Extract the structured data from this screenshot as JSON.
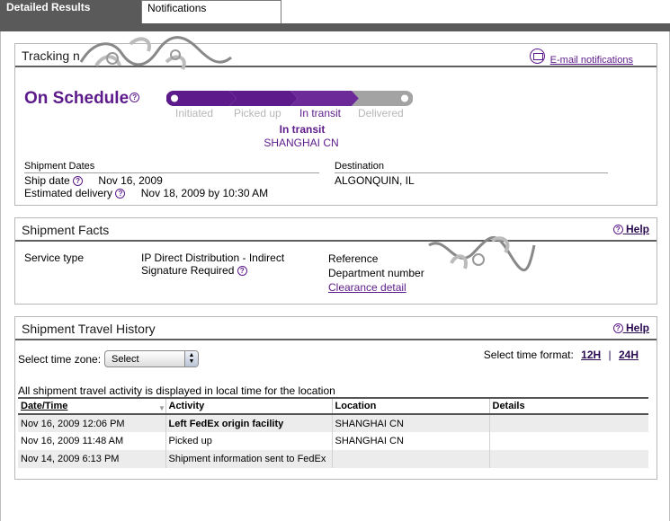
{
  "tabs": {
    "active_label": "Detailed Results",
    "inactive_label": "Notifications"
  },
  "tracking": {
    "title_visible": "Tracking n",
    "email_label": "E-mail notifications",
    "status": "On Schedule",
    "stages": [
      "Initiated",
      "Picked up",
      "In transit",
      "Delivered"
    ],
    "current_stage_index": 2,
    "current_status": "In transit",
    "current_location": "SHANGHAI CN",
    "dates_heading": "Shipment Dates",
    "ship_date_label": "Ship date",
    "ship_date": "Nov 16, 2009",
    "est_delivery_label": "Estimated delivery",
    "est_delivery": "Nov 18, 2009 by 10:30 AM",
    "destination_heading": "Destination",
    "destination": "ALGONQUIN, IL"
  },
  "facts": {
    "title": "Shipment Facts",
    "help": "Help",
    "service_type_label": "Service type",
    "service_line1": "IP Direct Distribution - Indirect",
    "service_line2": "Signature Required",
    "reference_label": "Reference",
    "department_label": "Department number",
    "clearance_link": "Clearance detail"
  },
  "history": {
    "title": "Shipment Travel History",
    "help": "Help",
    "tz_label": "Select time zone:",
    "tz_value": "Select",
    "time_format_label": "Select time format:",
    "fmt_12h": "12H",
    "fmt_sep": "|",
    "fmt_24h": "24H",
    "note": "All shipment travel activity is displayed in local time for the location",
    "columns": [
      "Date/Time",
      "Activity",
      "Location",
      "Details"
    ],
    "rows": [
      {
        "datetime": "Nov 16, 2009 12:06 PM",
        "activity": "Left FedEx origin facility",
        "location": "SHANGHAI CN",
        "details": ""
      },
      {
        "datetime": "Nov 16, 2009 11:48 AM",
        "activity": "Picked up",
        "location": "SHANGHAI CN",
        "details": ""
      },
      {
        "datetime": "Nov 14, 2009 6:13 PM",
        "activity": "Shipment information sent to FedEx",
        "location": "",
        "details": ""
      }
    ]
  },
  "colors": {
    "brand_purple": "#5d1a8a",
    "progress_gray": "#9a9a9a",
    "header_dark": "#5a5a5a"
  }
}
